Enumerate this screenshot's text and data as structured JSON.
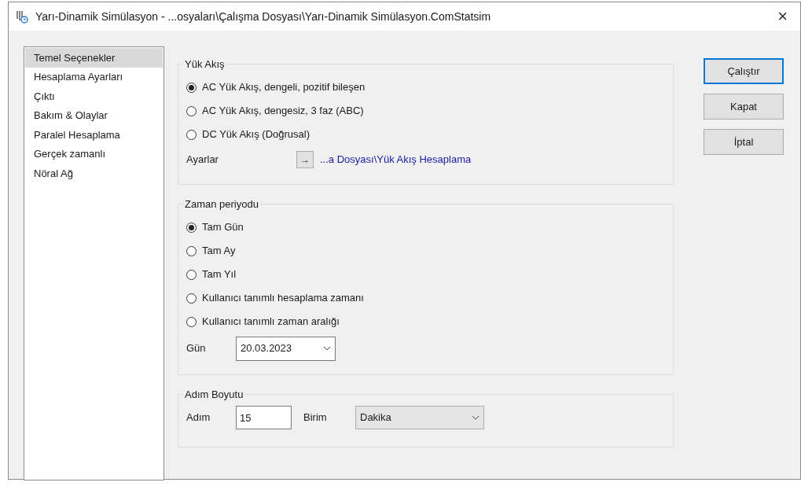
{
  "window": {
    "title": "Yarı-Dinamik Simülasyon - ...osyaları\\Çalışma Dosyası\\Yarı-Dinamik Simülasyon.ComStatsim",
    "close": "×"
  },
  "sidebar": {
    "items": [
      {
        "label": "Temel Seçenekler",
        "selected": true
      },
      {
        "label": "Hesaplama Ayarları",
        "selected": false
      },
      {
        "label": "Çıktı",
        "selected": false
      },
      {
        "label": "Bakım & Olaylar",
        "selected": false
      },
      {
        "label": "Paralel Hesaplama",
        "selected": false
      },
      {
        "label": "Gerçek zamanlı",
        "selected": false
      },
      {
        "label": "Nöral Ağ",
        "selected": false
      }
    ]
  },
  "load_flow": {
    "title": "Yük Akış",
    "options": [
      {
        "label": "AC Yük Akış, dengeli, pozitif bileşen",
        "selected": true
      },
      {
        "label": "AC Yük Akış, dengesiz, 3 faz (ABC)",
        "selected": false
      },
      {
        "label": "DC Yük Akış (Doğrusal)",
        "selected": false
      }
    ],
    "settings_label": "Ayarlar",
    "settings_arrow": "→",
    "settings_link": "...a Dosyası\\Yük Akış Hesaplama"
  },
  "time_period": {
    "title": "Zaman periyodu",
    "options": [
      {
        "label": "Tam Gün",
        "selected": true
      },
      {
        "label": "Tam Ay",
        "selected": false
      },
      {
        "label": "Tam Yıl",
        "selected": false
      },
      {
        "label": "Kullanıcı tanımlı hesaplama zamanı",
        "selected": false
      },
      {
        "label": "Kullanıcı tanımlı zaman aralığı",
        "selected": false
      }
    ],
    "day_label": "Gün",
    "day_value": "20.03.2023"
  },
  "step_size": {
    "title": "Adım Boyutu",
    "step_label": "Adım",
    "step_value": "15",
    "unit_label": "Birim",
    "unit_value": "Dakika"
  },
  "buttons": [
    {
      "label": "Çalıştır",
      "default": true
    },
    {
      "label": "Kapat",
      "default": false
    },
    {
      "label": "İptal",
      "default": false
    }
  ]
}
